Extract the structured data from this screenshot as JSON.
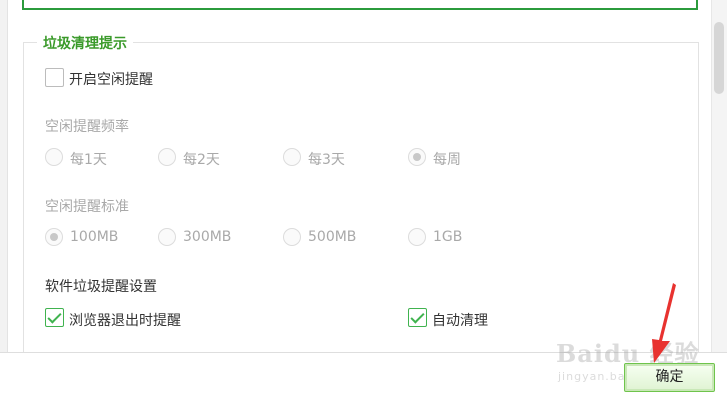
{
  "section": {
    "title": "垃圾清理提示",
    "idle_reminder": {
      "label": "开启空闲提醒",
      "checked": false
    },
    "frequency": {
      "heading": "空闲提醒频率",
      "options": [
        "每1天",
        "每2天",
        "每3天",
        "每周"
      ],
      "selected": "每周"
    },
    "threshold": {
      "heading": "空闲提醒标准",
      "options": [
        "100MB",
        "300MB",
        "500MB",
        "1GB"
      ],
      "selected": "100MB"
    },
    "software": {
      "heading": "软件垃圾提醒设置",
      "browser_exit": {
        "label": "浏览器退出时提醒",
        "checked": true
      },
      "auto_clean": {
        "label": "自动清理",
        "checked": true
      }
    }
  },
  "footer": {
    "confirm_label": "确定"
  },
  "watermark": {
    "main": "Baidu 经验",
    "sub": "jingyan.baidu.com"
  },
  "colors": {
    "accent_green": "#3a9a2a",
    "check_green": "#40b34f",
    "arrow_red": "#e8322f"
  }
}
